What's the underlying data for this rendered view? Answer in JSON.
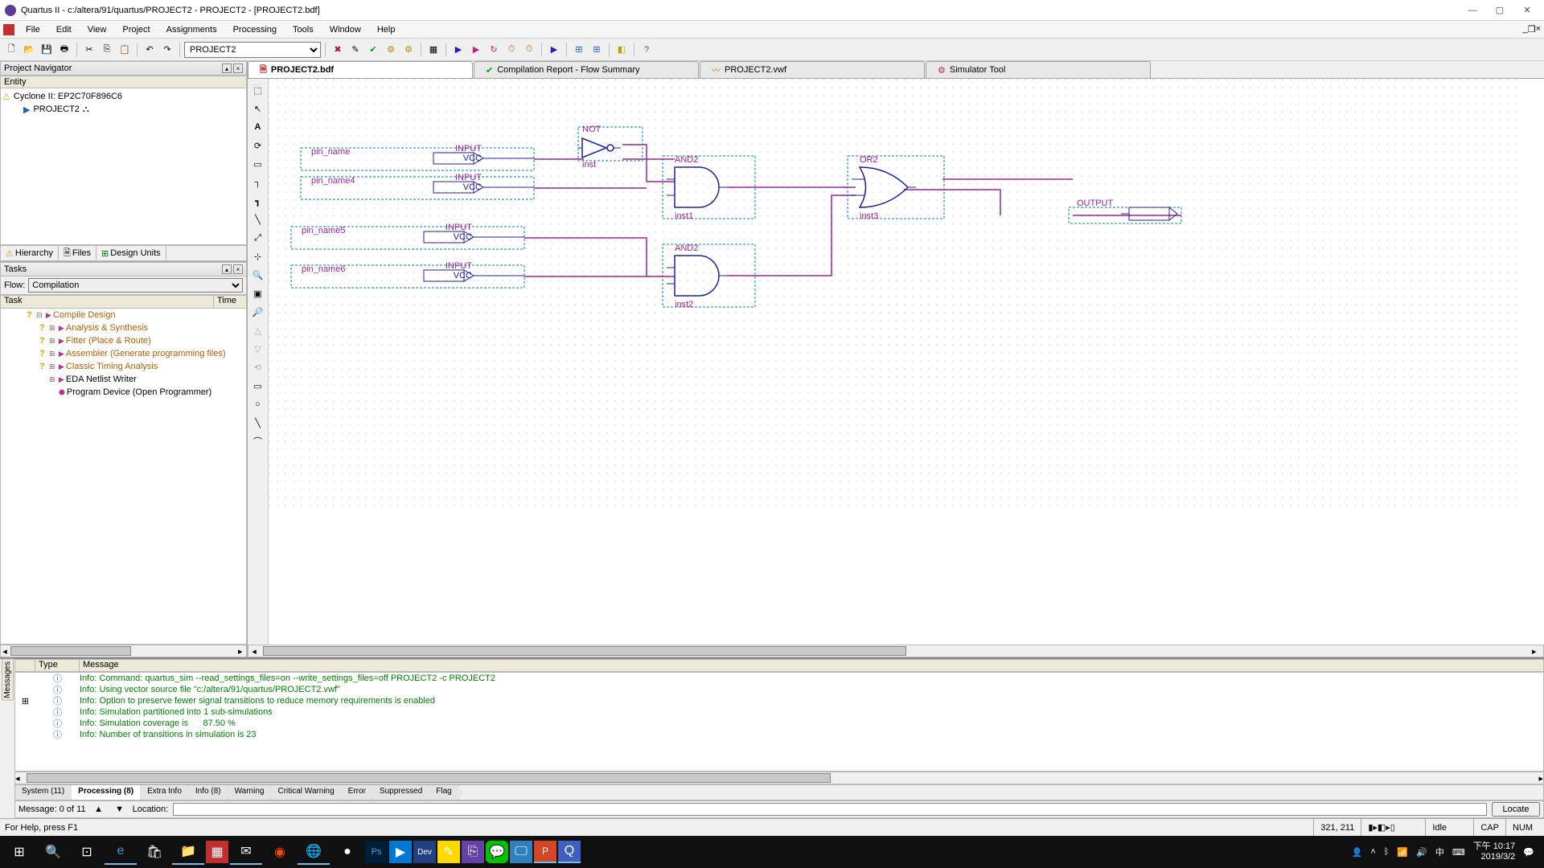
{
  "title": "Quartus II - c:/altera/91/quartus/PROJECT2 - PROJECT2 - [PROJECT2.bdf]",
  "menus": [
    "File",
    "Edit",
    "View",
    "Project",
    "Assignments",
    "Processing",
    "Tools",
    "Window",
    "Help"
  ],
  "project_combo": "PROJECT2",
  "nav": {
    "header": "Project Navigator",
    "entity_label": "Entity",
    "device": "Cyclone II: EP2C70F896C6",
    "project": "PROJECT2",
    "tabs": [
      "Hierarchy",
      "Files",
      "Design Units"
    ]
  },
  "tasks": {
    "header": "Tasks",
    "flow_label": "Flow:",
    "flow_value": "Compilation",
    "col_task": "Task",
    "col_time": "Time",
    "items": [
      {
        "q": true,
        "lvl": 1,
        "expand": "⊟",
        "run": true,
        "label": "Compile Design",
        "cls": "orange"
      },
      {
        "q": true,
        "lvl": 2,
        "expand": "⊞",
        "run": true,
        "label": "Analysis & Synthesis",
        "cls": "orange"
      },
      {
        "q": true,
        "lvl": 2,
        "expand": "⊞",
        "run": true,
        "label": "Fitter (Place & Route)",
        "cls": "orange"
      },
      {
        "q": true,
        "lvl": 2,
        "expand": "⊞",
        "run": true,
        "label": "Assembler (Generate programming files)",
        "cls": "orange"
      },
      {
        "q": true,
        "lvl": 2,
        "expand": "⊞",
        "run": true,
        "label": "Classic Timing Analysis",
        "cls": "orange"
      },
      {
        "q": false,
        "lvl": 2,
        "expand": "⊞",
        "run": true,
        "label": "EDA Netlist Writer",
        "cls": ""
      },
      {
        "q": false,
        "lvl": 2,
        "expand": "",
        "run": false,
        "label": "Program Device (Open Programmer)",
        "cls": ""
      }
    ]
  },
  "doctabs": [
    {
      "icon": "bdf",
      "label": "PROJECT2.bdf",
      "active": true
    },
    {
      "icon": "rpt",
      "label": "Compilation Report - Flow Summary",
      "active": false
    },
    {
      "icon": "wave",
      "label": "PROJECT2.vwf",
      "active": false
    },
    {
      "icon": "sim",
      "label": "Simulator Tool",
      "active": false
    }
  ],
  "schematic": {
    "inputs": [
      {
        "name": "pin_name",
        "type": "INPUT",
        "sub": "VCC"
      },
      {
        "name": "pin_name4",
        "type": "INPUT",
        "sub": "VCC"
      },
      {
        "name": "pin_name5",
        "type": "INPUT",
        "sub": "VCC"
      },
      {
        "name": "pin_name6",
        "type": "INPUT",
        "sub": "VCC"
      }
    ],
    "gates": [
      {
        "type": "NOT",
        "inst": "inst"
      },
      {
        "type": "AND2",
        "inst": "inst1"
      },
      {
        "type": "AND2",
        "inst": "inst2"
      },
      {
        "type": "OR2",
        "inst": "inst3"
      }
    ],
    "output": "OUTPUT"
  },
  "messages": {
    "col_type": "Type",
    "col_msg": "Message",
    "rows": [
      "Info: Command: quartus_sim --read_settings_files=on --write_settings_files=off PROJECT2 -c PROJECT2",
      "Info: Using vector source file \"c:/altera/91/quartus/PROJECT2.vwf\"",
      "Info: Option to preserve fewer signal transitions to reduce memory requirements is enabled",
      "Info: Simulation partitioned into 1 sub-simulations",
      "Info: Simulation coverage is      87.50 %",
      "Info: Number of transitions in simulation is 23"
    ],
    "tabs": [
      "System (11)",
      "Processing (8)",
      "Extra Info",
      "Info (8)",
      "Warning",
      "Critical Warning",
      "Error",
      "Suppressed",
      "Flag"
    ],
    "active_tab": 1,
    "footer_msg": "Message: 0 of 11",
    "location_label": "Location:",
    "locate_btn": "Locate",
    "side_label": "Messages"
  },
  "status": {
    "help": "For Help, press F1",
    "coords": "321, 211",
    "idle": "Idle",
    "cap": "CAP",
    "num": "NUM"
  },
  "taskbar": {
    "time": "下午 10:17",
    "date": "2019/3/2"
  }
}
